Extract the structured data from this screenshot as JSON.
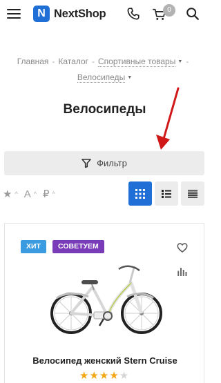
{
  "header": {
    "logo_letter": "N",
    "logo_text": "NextShop",
    "cart_count": "0"
  },
  "breadcrumbs": [
    {
      "label": "Главная"
    },
    {
      "label": "Каталог"
    },
    {
      "label": "Спортивные товары"
    },
    {
      "label": "Велосипеды"
    }
  ],
  "page_title": "Велосипеды",
  "filter": {
    "label": "Фильтр"
  },
  "sort": {
    "name_sort_letter": "A",
    "price_sort_symbol": "₽"
  },
  "product": {
    "badges": [
      "ХИТ",
      "СОВЕТУЕМ"
    ],
    "name": "Велосипед женский Stern Cruise",
    "rating": 4,
    "rating_max": 5
  },
  "colors": {
    "accent": "#1f6fd6",
    "badge_hit": "#3b9be0",
    "badge_recommend": "#7a3bb8",
    "star_on": "#f3a712",
    "star_off": "#d6d6d6"
  }
}
